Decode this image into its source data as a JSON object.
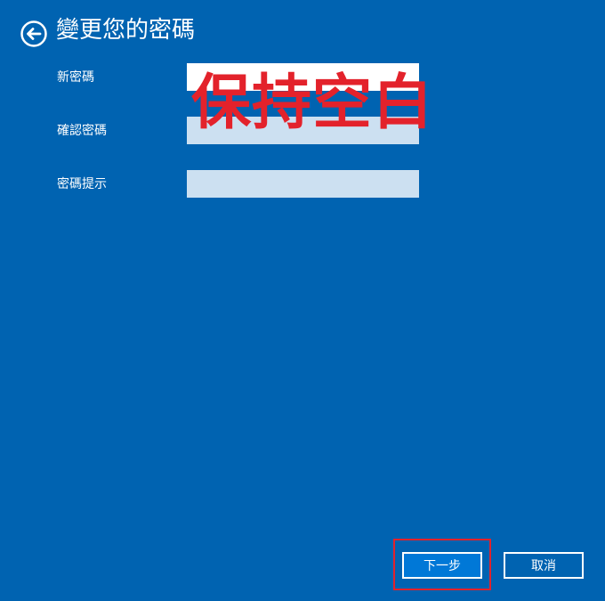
{
  "header": {
    "back_icon": "arrow-left-circle-icon",
    "title": "變更您的密碼"
  },
  "form": {
    "fields": [
      {
        "label": "新密碼",
        "value": ""
      },
      {
        "label": "確認密碼",
        "value": ""
      },
      {
        "label": "密碼提示",
        "value": ""
      }
    ]
  },
  "annotation": {
    "overlay_text": "保持空白",
    "color": "#e3222b"
  },
  "footer": {
    "next_label": "下一步",
    "cancel_label": "取消"
  },
  "colors": {
    "background": "#0063b1",
    "primary_button": "#0078d7",
    "input_active": "#ffffff",
    "input_inactive": "#cce0f1"
  }
}
